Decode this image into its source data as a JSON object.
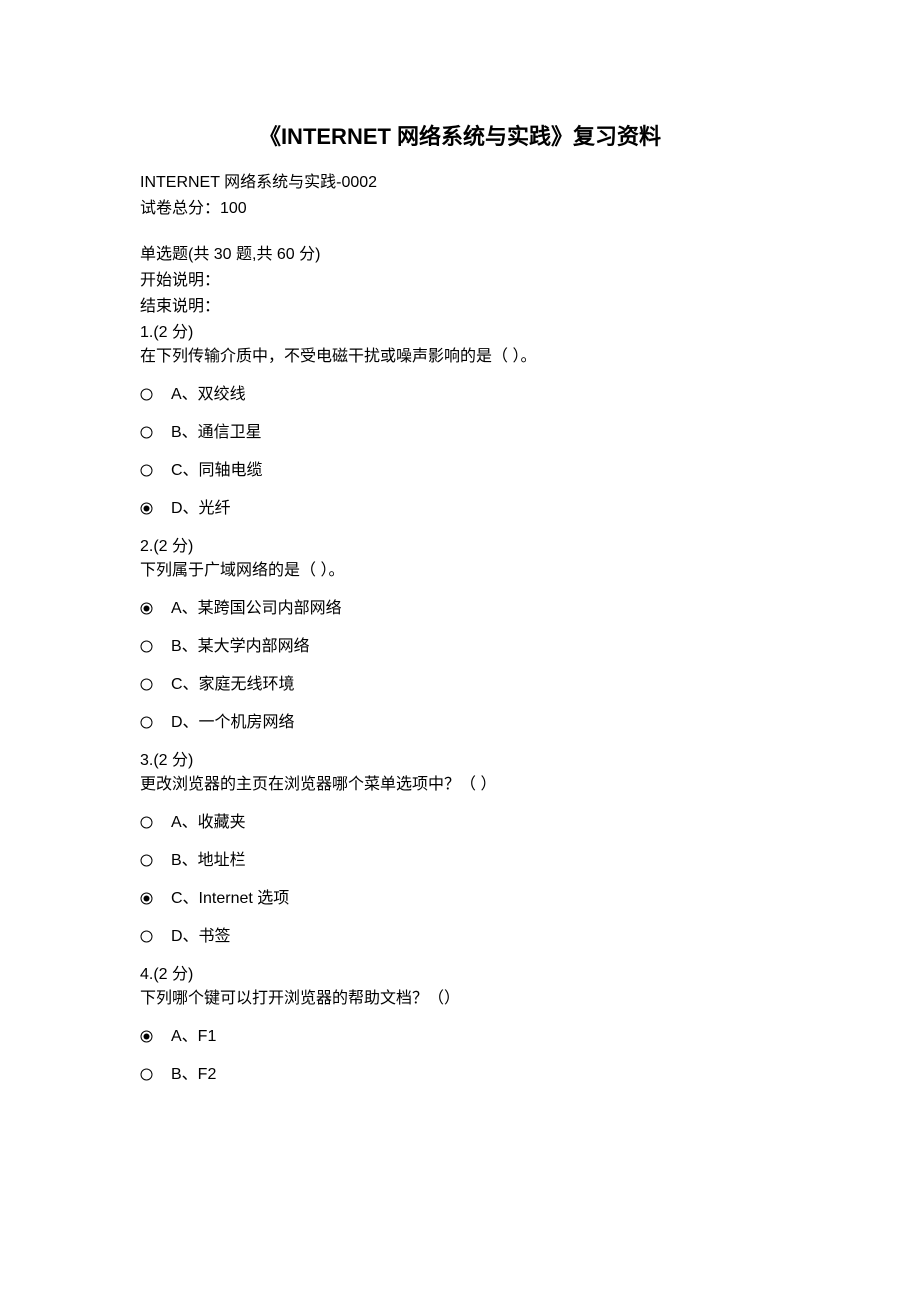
{
  "title": "《INTERNET 网络系统与实践》复习资料",
  "subtitle": "INTERNET 网络系统与实践-0002",
  "total_score": "试卷总分：100",
  "section_header": "单选题(共 30 题,共 60 分)",
  "start_note": "开始说明：",
  "end_note": "结束说明：",
  "questions": [
    {
      "num": "1.(2 分)",
      "text": "在下列传输介质中，不受电磁干扰或噪声影响的是（ ）。",
      "options": [
        {
          "label": "A、双绞线",
          "selected": false
        },
        {
          "label": "B、通信卫星",
          "selected": false
        },
        {
          "label": "C、同轴电缆",
          "selected": false
        },
        {
          "label": "D、光纤",
          "selected": true
        }
      ]
    },
    {
      "num": "2.(2 分)",
      "text": "下列属于广域网络的是（ ）。",
      "options": [
        {
          "label": "A、某跨国公司内部网络",
          "selected": true
        },
        {
          "label": "B、某大学内部网络",
          "selected": false
        },
        {
          "label": "C、家庭无线环境",
          "selected": false
        },
        {
          "label": "D、一个机房网络",
          "selected": false
        }
      ]
    },
    {
      "num": "3.(2 分)",
      "text": "更改浏览器的主页在浏览器哪个菜单选项中？（ ）",
      "options": [
        {
          "label": "A、收藏夹",
          "selected": false
        },
        {
          "label": "B、地址栏",
          "selected": false
        },
        {
          "label": "C、Internet 选项",
          "selected": true
        },
        {
          "label": "D、书签",
          "selected": false
        }
      ]
    },
    {
      "num": "4.(2 分)",
      "text": "下列哪个键可以打开浏览器的帮助文档？（）",
      "options": [
        {
          "label": "A、F1",
          "selected": true
        },
        {
          "label": "B、F2",
          "selected": false
        }
      ]
    }
  ]
}
